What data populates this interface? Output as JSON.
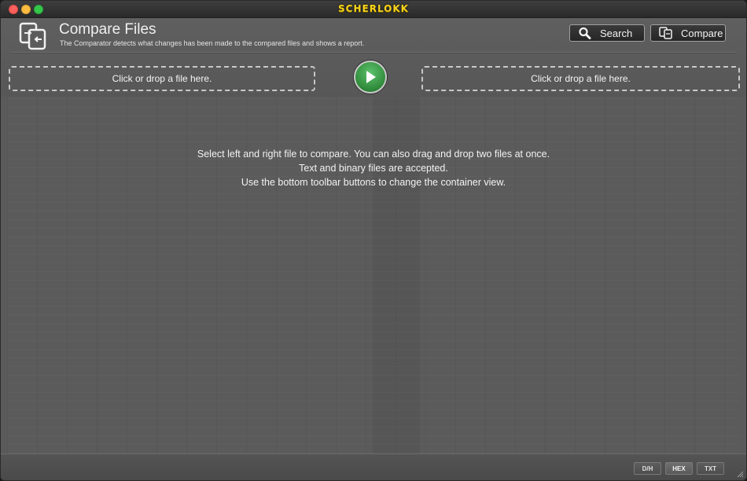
{
  "app": {
    "title": "SCHERLOKK"
  },
  "header": {
    "title": "Compare Files",
    "subtitle": "The Comparator detects what changes has been made to the compared files and shows a report.",
    "icon": "compare-files-icon"
  },
  "toolbar": {
    "search_label": "Search",
    "compare_label": "Compare"
  },
  "dropzones": {
    "left_label": "Click or drop a file here.",
    "right_label": "Click or drop a file here."
  },
  "main": {
    "hint_lines": [
      "Select left and right file to compare. You can also drag and drop two files at once.",
      "Text and binary files are accepted.",
      "Use the bottom toolbar buttons to change the container view."
    ]
  },
  "bottom_toolbar": {
    "views": [
      "D/H",
      "HEX",
      "TXT"
    ],
    "selected": "HEX"
  },
  "colors": {
    "accent_title": "#f6d31c",
    "play_green": "#3a9a46",
    "background": "#5a5a5a"
  }
}
